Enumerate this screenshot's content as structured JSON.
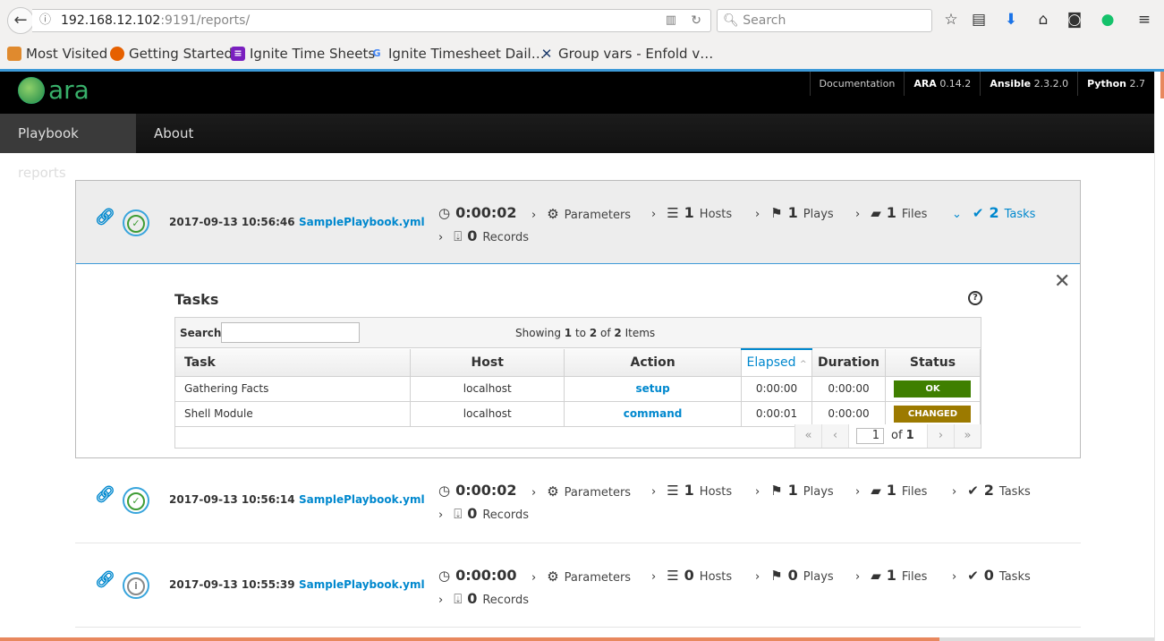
{
  "browser": {
    "url_host": "192.168.12.102",
    "url_rest": ":9191/reports/",
    "search_placeholder": "Search",
    "bookmarks": [
      "Most Visited",
      "Getting Started",
      "Ignite Time Sheets",
      "Ignite Timesheet Dail…",
      "Group vars - Enfold v…"
    ]
  },
  "header": {
    "logo_text": "ara",
    "documentation": "Documentation",
    "ara_label": "ARA",
    "ara_version": "0.14.2",
    "ansible_label": "Ansible",
    "ansible_version": "2.3.2.0",
    "python_label": "Python",
    "python_version": "2.7"
  },
  "nav": {
    "items": [
      "Playbook reports",
      "About"
    ]
  },
  "playbooks": [
    {
      "date": "2017-09-13 10:56:46",
      "file": "SamplePlaybook.yml",
      "status": "success",
      "duration": "0:00:02",
      "parameters": "Parameters",
      "hosts": "1",
      "hosts_label": "Hosts",
      "plays": "1",
      "plays_label": "Plays",
      "files": "1",
      "files_label": "Files",
      "tasks": "2",
      "tasks_label": "Tasks",
      "records": "0",
      "records_label": "Records"
    },
    {
      "date": "2017-09-13 10:56:14",
      "file": "SamplePlaybook.yml",
      "status": "success",
      "duration": "0:00:02",
      "parameters": "Parameters",
      "hosts": "1",
      "hosts_label": "Hosts",
      "plays": "1",
      "plays_label": "Plays",
      "files": "1",
      "files_label": "Files",
      "tasks": "2",
      "tasks_label": "Tasks",
      "records": "0",
      "records_label": "Records"
    },
    {
      "date": "2017-09-13 10:55:39",
      "file": "SamplePlaybook.yml",
      "status": "unknown",
      "duration": "0:00:00",
      "parameters": "Parameters",
      "hosts": "0",
      "hosts_label": "Hosts",
      "plays": "0",
      "plays_label": "Plays",
      "files": "1",
      "files_label": "Files",
      "tasks": "0",
      "tasks_label": "Tasks",
      "records": "0",
      "records_label": "Records"
    }
  ],
  "tasks": {
    "title": "Tasks",
    "search_label": "Search:",
    "showing_pre": "Showing",
    "from": "1",
    "to_word": "to",
    "to": "2",
    "of_word": "of",
    "total": "2",
    "items_word": "Items",
    "columns": [
      "Task",
      "Host",
      "Action",
      "Elapsed",
      "Duration",
      "Status"
    ],
    "rows": [
      {
        "task": "Gathering Facts",
        "host": "localhost",
        "action": "setup",
        "elapsed": "0:00:00",
        "duration": "0:00:00",
        "status": "OK",
        "status_color": "#3f7f00"
      },
      {
        "task": "Shell Module",
        "host": "localhost",
        "action": "command",
        "elapsed": "0:00:01",
        "duration": "0:00:00",
        "status": "CHANGED",
        "status_color": "#9c7a00"
      }
    ],
    "page": "1",
    "page_of": "of",
    "page_total": "1"
  }
}
